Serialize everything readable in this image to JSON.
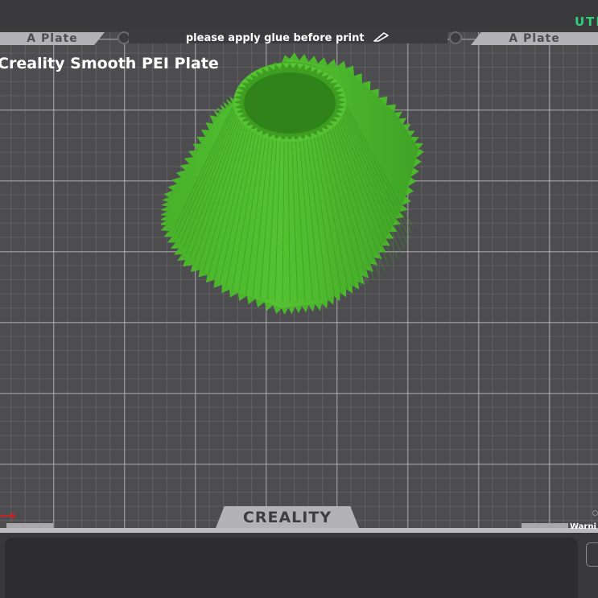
{
  "top": {
    "plate_tab_left": "A Plate",
    "plate_tab_right": "A Plate",
    "notice_text": "please apply glue before print",
    "status_text": "UTI"
  },
  "bed": {
    "plate_name": "Creality Smooth PEI Plate",
    "brand_label": "CREALITY",
    "warning_text": "Warni"
  },
  "colors": {
    "model": "#4db82e",
    "bed": "#4d4d50",
    "status": "#2fd07a",
    "axis_x": "#c42424"
  },
  "icons": {
    "edit": "edit-icon",
    "x_axis": "x-axis-arrow-icon"
  }
}
